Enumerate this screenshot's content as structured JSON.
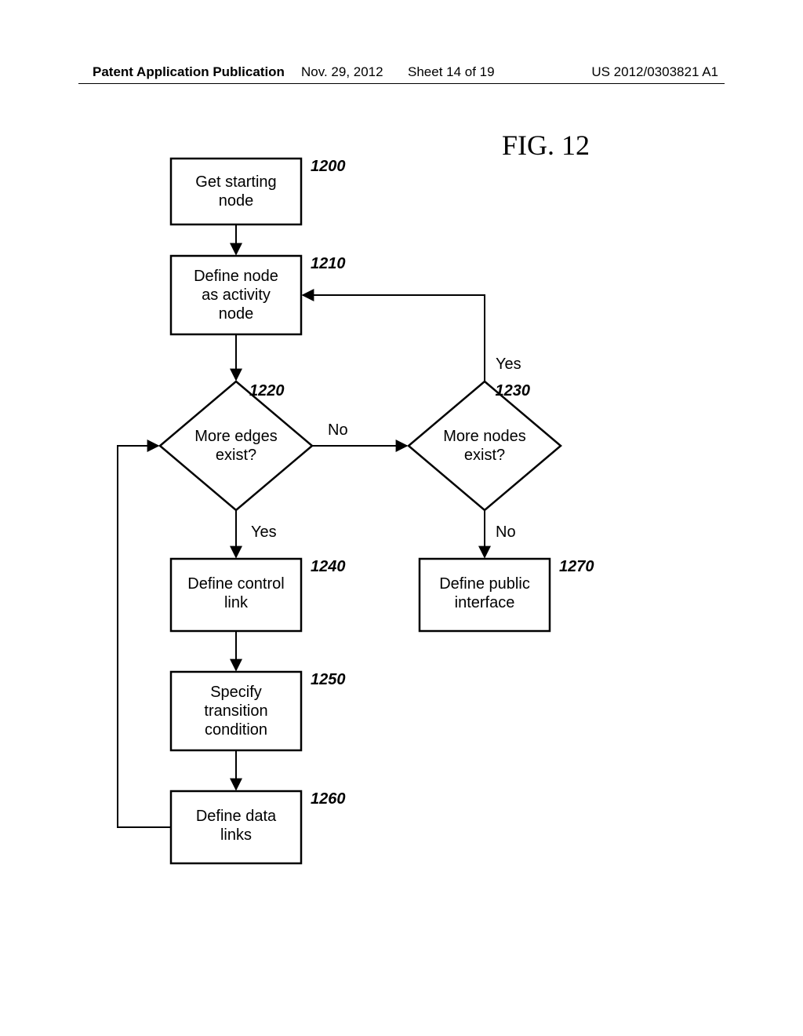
{
  "header": {
    "left": "Patent Application Publication",
    "mid_date": "Nov. 29, 2012",
    "mid_sheet": "Sheet 14 of 19",
    "right": "US 2012/0303821 A1"
  },
  "figure_title": "FIG. 12",
  "nodes": {
    "n1200": {
      "ref": "1200",
      "line1": "Get starting",
      "line2": "node"
    },
    "n1210": {
      "ref": "1210",
      "line1": "Define node",
      "line2": "as activity",
      "line3": "node"
    },
    "n1220": {
      "ref": "1220",
      "line1": "More edges",
      "line2": "exist?"
    },
    "n1230": {
      "ref": "1230",
      "line1": "More nodes",
      "line2": "exist?"
    },
    "n1240": {
      "ref": "1240",
      "line1": "Define control",
      "line2": "link"
    },
    "n1250": {
      "ref": "1250",
      "line1": "Specify",
      "line2": "transition",
      "line3": "condition"
    },
    "n1260": {
      "ref": "1260",
      "line1": "Define data",
      "line2": "links"
    },
    "n1270": {
      "ref": "1270",
      "line1": "Define public",
      "line2": "interface"
    }
  },
  "edge_labels": {
    "no_1220": "No",
    "yes_1220": "Yes",
    "yes_1230": "Yes",
    "no_1230": "No"
  }
}
